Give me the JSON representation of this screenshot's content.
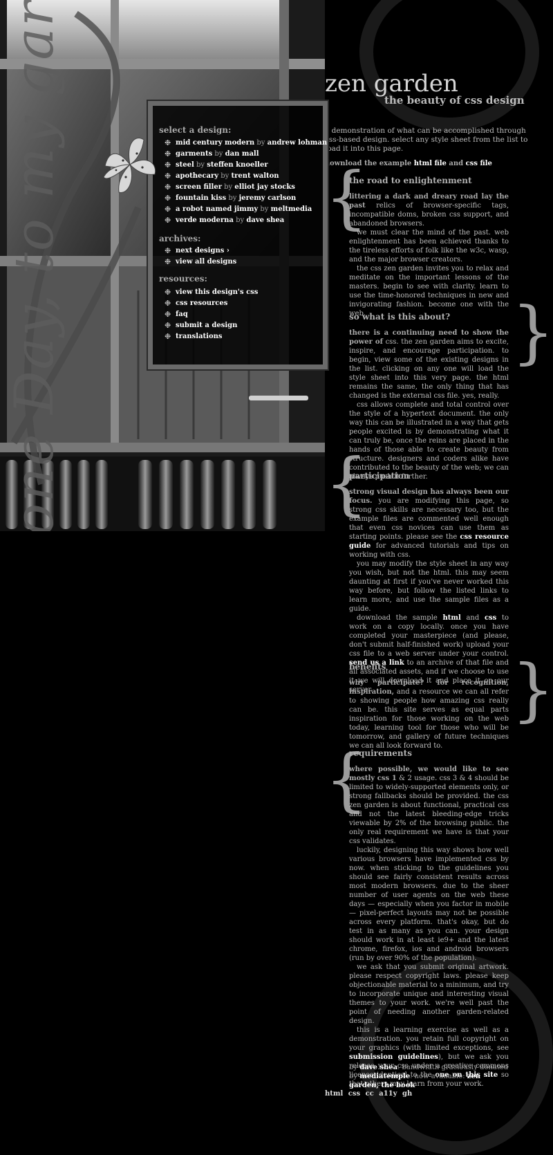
{
  "header": {
    "title": "zen garden",
    "subtitle": "the beauty of css design",
    "summary": "a demonstration of what can be accomplished through css-based design. select any style sheet from the list to load it into this page.",
    "download_prefix": "download the example",
    "download_html": "html file",
    "download_and": "and",
    "download_css": "css file"
  },
  "decor": {
    "script_text": "one Day, to my garden"
  },
  "nav": {
    "select_heading": "select a design:",
    "designs": [
      {
        "name": "mid century modern",
        "by": "by",
        "author": "andrew lohman"
      },
      {
        "name": "garments",
        "by": "by",
        "author": "dan mall"
      },
      {
        "name": "steel",
        "by": "by",
        "author": "steffen knoeller"
      },
      {
        "name": "apothecary",
        "by": "by",
        "author": "trent walton"
      },
      {
        "name": "screen filler",
        "by": "by",
        "author": "elliot jay stocks"
      },
      {
        "name": "fountain kiss",
        "by": "by",
        "author": "jeremy carlson"
      },
      {
        "name": "a robot named jimmy",
        "by": "by",
        "author": "meltmedia"
      },
      {
        "name": "verde moderna",
        "by": "by",
        "author": "dave shea"
      }
    ],
    "archives_heading": "archives:",
    "archives": [
      "next designs ›",
      "view all designs"
    ],
    "resources_heading": "resources:",
    "resources": [
      "view this design's css",
      "css resources",
      "faq",
      "submit a design",
      "translations"
    ]
  },
  "sections": [
    {
      "heading": "the road to enlightenment",
      "paragraphs": [
        {
          "lead": "littering a dark and dreary road lay the past",
          "text": " relics of browser-specific tags, incompatible doms, broken css support, and abandoned browsers."
        },
        {
          "lead": "",
          "text": "we must clear the mind of the past. web enlightenment has been achieved thanks to the tireless efforts of folk like the w3c, wasp, and the major browser creators."
        },
        {
          "lead": "",
          "text": "the css zen garden invites you to relax and meditate on the important lessons of the masters. begin to see with clarity. learn to use the time-honored techniques in new and invigorating fashion. become one with the web."
        }
      ]
    },
    {
      "heading": "so what is this about?",
      "paragraphs": [
        {
          "lead": "there is a continuing need to show the power of",
          "text": " css. the zen garden aims to excite, inspire, and encourage participation. to begin, view some of the existing designs in the list. clicking on any one will load the style sheet into this very page. the html remains the same, the only thing that has changed is the external css file. yes, really."
        },
        {
          "lead": "",
          "text": "css allows complete and total control over the style of a hypertext document. the only way this can be illustrated in a way that gets people excited is by demonstrating what it can truly be, once the reins are placed in the hands of those able to create beauty from structure. designers and coders alike have contributed to the beauty of the web; we can always push it further."
        }
      ]
    },
    {
      "heading": "participation",
      "p1_lead": "strong visual design has always been our focus.",
      "p1_text_a": " you are modifying this page, so strong css skills are necessary too, but the example files are commented well enough that even css novices can use them as starting points. please see the ",
      "p1_link": "css resource guide",
      "p1_text_b": " for advanced tutorials and tips on working with css.",
      "p2": "you may modify the style sheet in any way you wish, but not the html. this may seem daunting at first if you've never worked this way before, but follow the listed links to learn more, and use the sample files as a guide.",
      "p3_a": "download the sample ",
      "p3_html": "html",
      "p3_and": " and ",
      "p3_css": "css",
      "p3_b": " to work on a copy locally. once you have completed your masterpiece (and please, don't submit half-finished work) upload your css file to a web server under your control. ",
      "p3_link": "send us a link",
      "p3_c": " to an archive of that file and all associated assets, and if we choose to use it we will download it and place it on our server."
    },
    {
      "heading": "benefits",
      "paragraphs": [
        {
          "lead": "why participate? for recognition, inspiration,",
          "text": " and a resource we can all refer to showing people how amazing css really can be. this site serves as equal parts inspiration for those working on the web today, learning tool for those who will be tomorrow, and gallery of future techniques we can all look forward to."
        }
      ]
    },
    {
      "heading": "requirements",
      "p1_lead": "where possible, we would like to see mostly css 1",
      "p1_text": " & 2 usage. css 3 & 4 should be limited to widely-supported elements only, or strong fallbacks should be provided. the css zen garden is about functional, practical css and not the latest bleeding-edge tricks viewable by 2% of the browsing public. the only real requirement we have is that your css validates.",
      "p2": "luckily, designing this way shows how well various browsers have implemented css by now. when sticking to the guidelines you should see fairly consistent results across most modern browsers. due to the sheer number of user agents on the web these days — especially when you factor in mobile — pixel-perfect layouts may not be possible across every platform. that's okay, but do test in as many as you can. your design should work in at least ie9+ and the latest chrome, firefox, ios and android browsers (run by over 90% of the population).",
      "p3": "we ask that you submit original artwork. please respect copyright laws. please keep objectionable material to a minimum, and try to incorporate unique and interesting visual themes to your work. we're well past the point of needing another garden-related design.",
      "p4_a": "this is a learning exercise as well as a demonstration. you retain full copyright on your graphics (with limited exceptions, see ",
      "p4_link1": "submission guidelines",
      "p4_b": "), but we ask you release your css under a creative commons license identical to the ",
      "p4_link2": "one on this site",
      "p4_c": " so that others may learn from your work."
    }
  ],
  "credits": {
    "by": "by",
    "author": "dave shea",
    "bandwidth": ". bandwidth graciously donated by",
    "host": "mediatemple",
    "now": ". now available:",
    "book": "zen garden, the book"
  },
  "footer_links": [
    "html",
    "css",
    "cc",
    "a11y",
    "gh"
  ],
  "colors": {
    "background": "#000000",
    "text": "#bdbdbd",
    "link": "#ffffff",
    "panel_border": "#6a6a6a"
  }
}
